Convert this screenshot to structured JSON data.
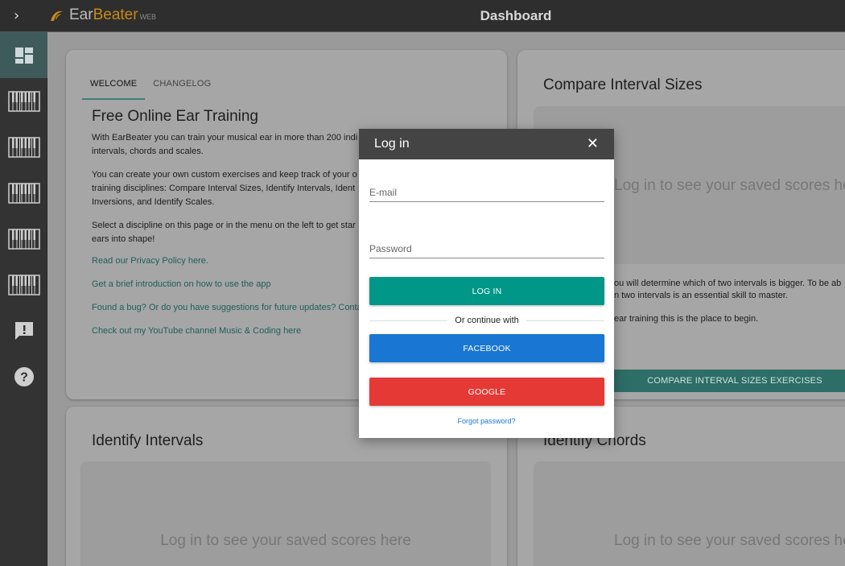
{
  "app": {
    "logo_ear": "Ear",
    "logo_beater": "Beater",
    "logo_web": "WEB",
    "page_title": "Dashboard"
  },
  "icons": {
    "expand": "chevron-right-icon",
    "sidebar": [
      "dashboard-icon",
      "piano-icon",
      "piano-icon",
      "piano-icon",
      "piano-icon",
      "piano-icon",
      "feedback-icon",
      "help-icon"
    ]
  },
  "welcome_card": {
    "tabs": [
      {
        "label": "WELCOME",
        "active": true
      },
      {
        "label": "CHANGELOG",
        "active": false
      }
    ],
    "title": "Free Online Ear Training",
    "paragraphs": [
      "With EarBeater you can train your musical ear in more than 200 indi intervals, chords and scales.",
      "You can create your own custom exercises and keep track of your o training disciplines: Compare Interval Sizes, Identify Intervals, Ident Inversions, and Identify Scales.",
      "Select a discipline on this page or in the menu on the left to get star ears into shape!"
    ],
    "links": [
      "Read our Privacy Policy here.",
      "Get a brief introduction on how to use the app",
      "Found a bug? Or do you have suggestions for future updates? Conta",
      "Check out my YouTube channel Music & Coding here"
    ]
  },
  "compare_card": {
    "title": "Compare Interval Sizes",
    "placeholder": "Log in to see your saved scores here",
    "lines": [
      "ou will determine which of two intervals is bigger. To be ab",
      "n two intervals is an essential skill to master.",
      "ear training this is the place to begin."
    ],
    "button": "COMPARE INTERVAL SIZES EXERCISES"
  },
  "identify_intervals_card": {
    "title": "Identify Intervals",
    "placeholder": "Log in to see your saved scores here"
  },
  "identify_chords_card": {
    "title": "Identify Chords",
    "placeholder": "Log in to see your saved scores here"
  },
  "modal": {
    "title": "Log in",
    "close_icon": "close-icon",
    "email_placeholder": "E-mail",
    "password_placeholder": "Password",
    "login_button": "LOG IN",
    "divider_text": "Or continue with",
    "facebook_button": "FACEBOOK",
    "google_button": "GOOGLE",
    "forgot_link": "Forgot password?"
  },
  "colors": {
    "topbar": "#2e2e2e",
    "sidebar": "#333333",
    "accent_teal": "#009688",
    "facebook_blue": "#1976d2",
    "google_red": "#e53935",
    "logo_orange": "#c78a1a"
  }
}
